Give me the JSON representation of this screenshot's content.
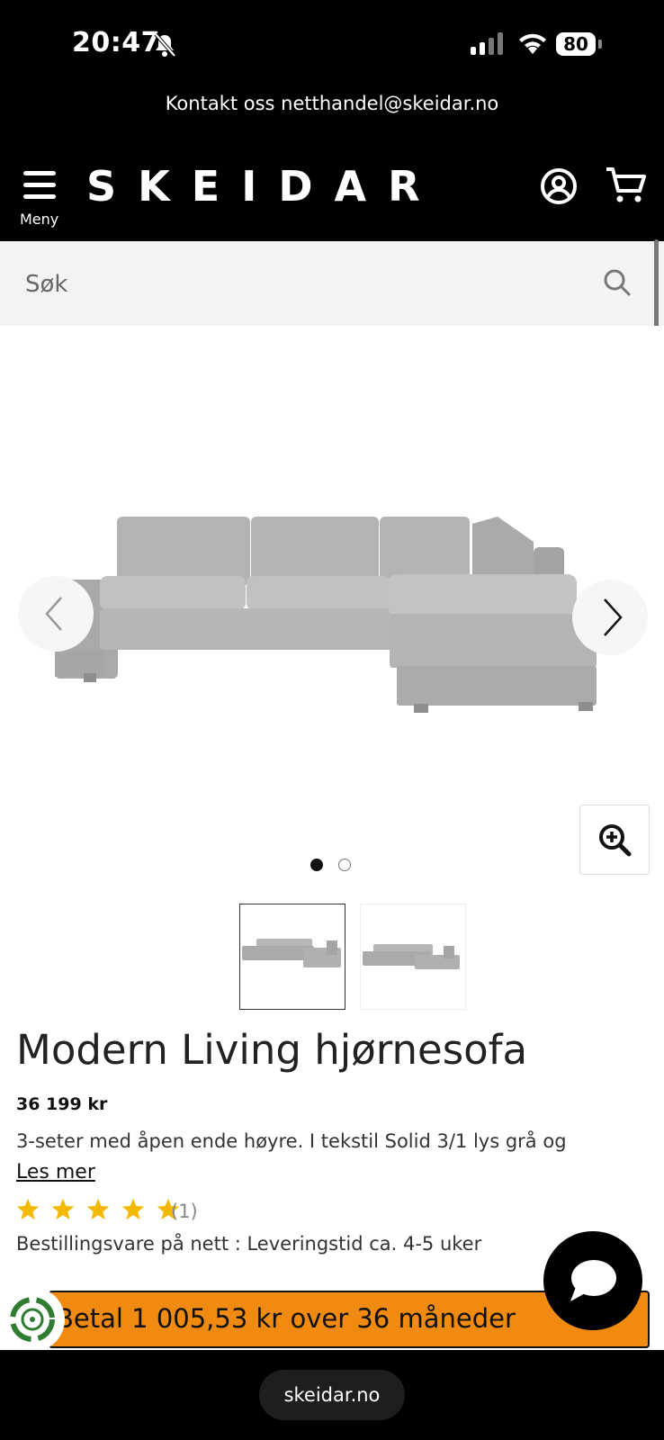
{
  "status_bar": {
    "time": "20:47",
    "battery": "80"
  },
  "contact_bar": {
    "text": "Kontakt oss netthandel@skeidar.no"
  },
  "header": {
    "menu_label": "Meny",
    "logo": "SKEIDAR"
  },
  "search": {
    "placeholder": "Søk"
  },
  "gallery": {
    "image_count": 2,
    "active_index": 1
  },
  "product": {
    "title": "Modern Living hjørnesofa",
    "price": "36 199 kr",
    "description": "3-seter med åpen ende høyre. I tekstil Solid 3/1 lys grå og",
    "read_more": "Les mer",
    "rating": 5,
    "review_count": "(1)",
    "delivery": "Bestillingsvare på nett : Leveringstid ca. 4-5 uker",
    "installment": "Betal 1 005,53 kr over 36 måneder"
  },
  "browser": {
    "url": "skeidar.no"
  },
  "colors": {
    "accent_orange": "#f08a10",
    "star_yellow": "#f5b800",
    "header_bg": "#000000"
  },
  "icons": [
    "bell-off-icon",
    "signal-icon",
    "wifi-icon",
    "battery-icon",
    "menu-icon",
    "user-icon",
    "cart-icon",
    "search-icon",
    "chevron-left-icon",
    "chevron-right-icon",
    "zoom-in-icon",
    "star-icon",
    "chat-icon"
  ]
}
